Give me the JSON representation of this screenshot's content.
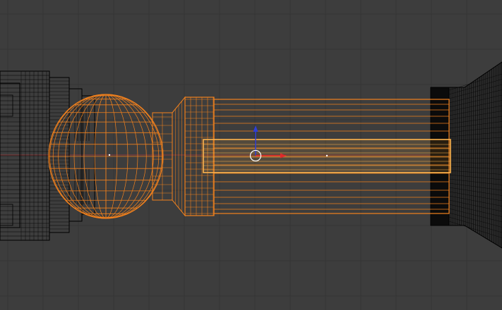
{
  "viewport": {
    "mode": "wireframe-orthographic-view",
    "background_color": "#3d3d3d",
    "grid_color": "#353535",
    "x_axis_color": "#8a3a3a",
    "selected_wire_color": "#f2811d",
    "active_face_color": "#ffb44d",
    "unselected_wire_color": "#000000"
  },
  "gizmo": {
    "type": "translate-manipulator",
    "x_handle_color": "#e02a2a",
    "z_handle_color": "#2f3fd6",
    "pivot_color": "#ffffff"
  },
  "objects": [
    {
      "name": "left-end-cap",
      "icon": "mesh-icon",
      "selected": false
    },
    {
      "name": "sphere-knob",
      "icon": "mesh-icon",
      "selected": true
    },
    {
      "name": "cylinder-shaft",
      "icon": "mesh-icon",
      "selected": true
    },
    {
      "name": "right-flared-cap",
      "icon": "mesh-icon",
      "selected": false
    }
  ]
}
